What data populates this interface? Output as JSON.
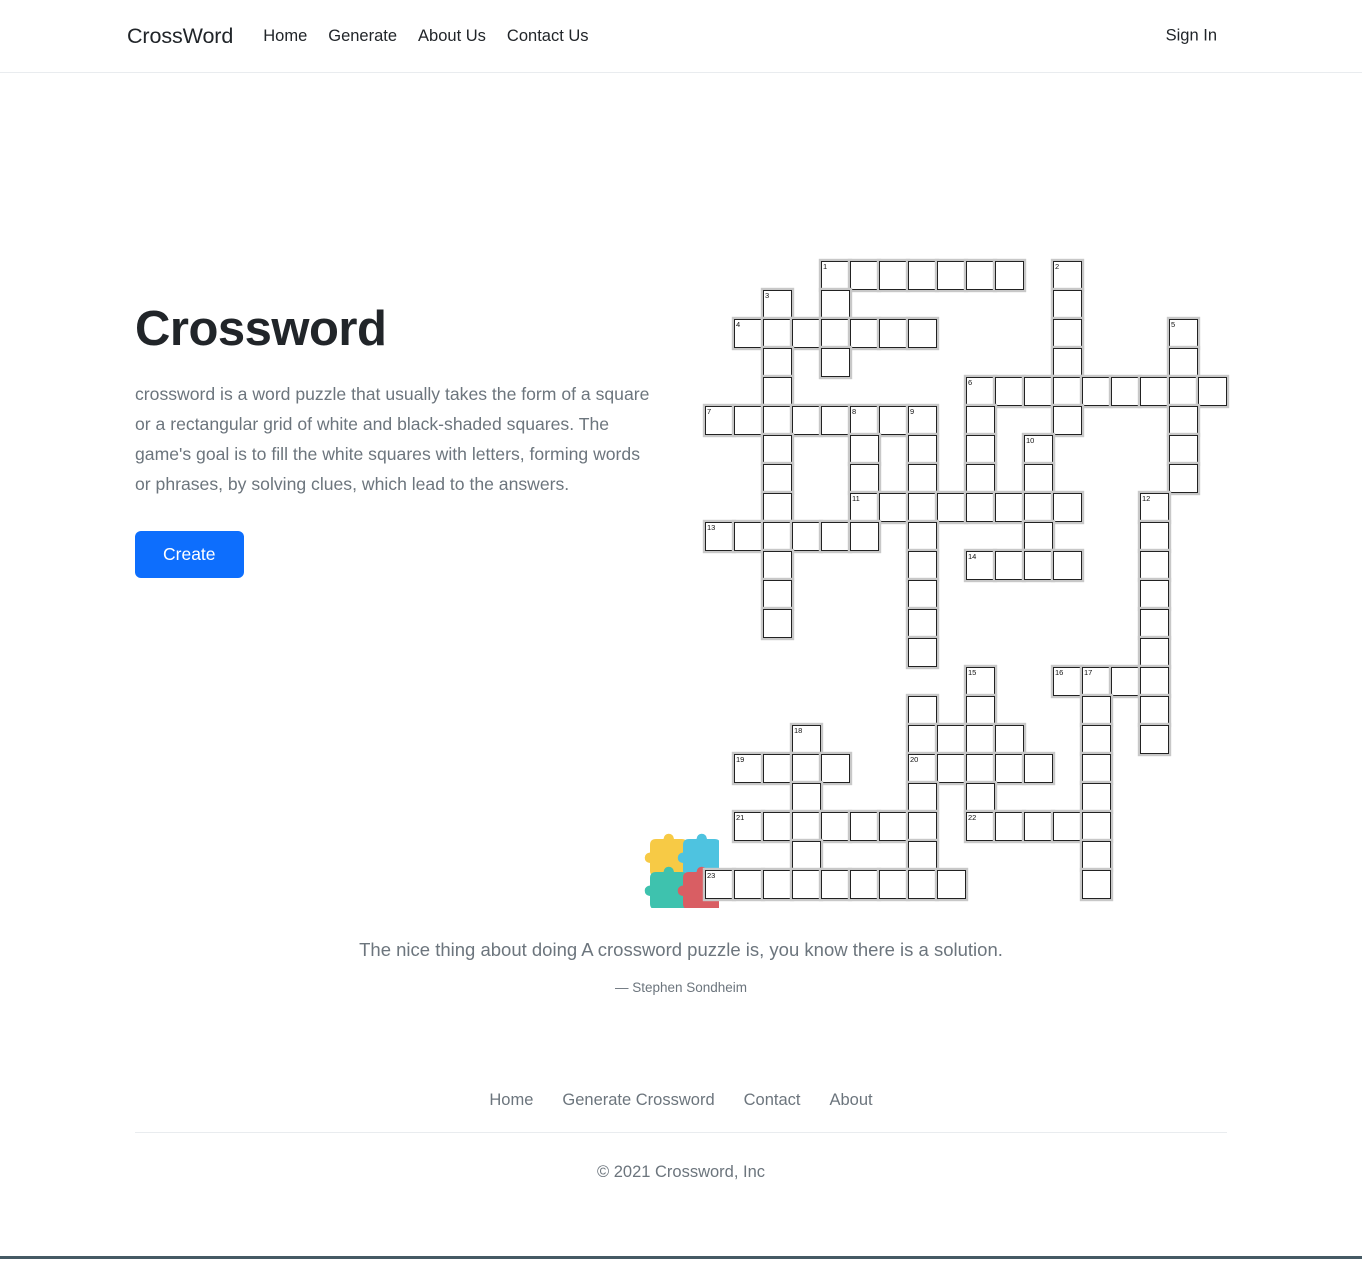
{
  "navbar": {
    "brand": "CrossWord",
    "links": [
      {
        "label": "Home",
        "name": "nav-link-home"
      },
      {
        "label": "Generate",
        "name": "nav-link-generate"
      },
      {
        "label": "About Us",
        "name": "nav-link-about-us"
      },
      {
        "label": "Contact Us",
        "name": "nav-link-contact-us"
      }
    ],
    "sign_in": "Sign In"
  },
  "hero": {
    "title": "Crossword",
    "description": "crossword is a word puzzle that usually takes the form of a square or a rectangular grid of white and black-shaded squares. The game's goal is to fill the white squares with letters, forming words or phrases, by solving clues, which lead to the answers.",
    "create_button": "Create",
    "illustration_name": "crossword-grid-illustration"
  },
  "crossword": {
    "cell_size": 29,
    "numbers": [
      1,
      2,
      3,
      4,
      5,
      6,
      7,
      8,
      9,
      10,
      11,
      12,
      13,
      14,
      15,
      16,
      17,
      18,
      19,
      20,
      21,
      22,
      23
    ],
    "cells": [
      {
        "c": 4,
        "r": 0,
        "n": "1"
      },
      {
        "c": 5,
        "r": 0
      },
      {
        "c": 6,
        "r": 0
      },
      {
        "c": 7,
        "r": 0
      },
      {
        "c": 8,
        "r": 0
      },
      {
        "c": 9,
        "r": 0
      },
      {
        "c": 10,
        "r": 0
      },
      {
        "c": 12,
        "r": 0,
        "n": "2"
      },
      {
        "c": 2,
        "r": 1,
        "n": "3"
      },
      {
        "c": 4,
        "r": 1
      },
      {
        "c": 12,
        "r": 1
      },
      {
        "c": 1,
        "r": 2,
        "n": "4"
      },
      {
        "c": 2,
        "r": 2
      },
      {
        "c": 3,
        "r": 2
      },
      {
        "c": 4,
        "r": 2
      },
      {
        "c": 5,
        "r": 2
      },
      {
        "c": 6,
        "r": 2
      },
      {
        "c": 7,
        "r": 2
      },
      {
        "c": 12,
        "r": 2
      },
      {
        "c": 16,
        "r": 2,
        "n": "5"
      },
      {
        "c": 2,
        "r": 3
      },
      {
        "c": 4,
        "r": 3
      },
      {
        "c": 12,
        "r": 3
      },
      {
        "c": 16,
        "r": 3
      },
      {
        "c": 2,
        "r": 4
      },
      {
        "c": 9,
        "r": 4,
        "n": "6"
      },
      {
        "c": 10,
        "r": 4
      },
      {
        "c": 11,
        "r": 4
      },
      {
        "c": 12,
        "r": 4
      },
      {
        "c": 13,
        "r": 4
      },
      {
        "c": 14,
        "r": 4
      },
      {
        "c": 15,
        "r": 4
      },
      {
        "c": 16,
        "r": 4
      },
      {
        "c": 17,
        "r": 4
      },
      {
        "c": 0,
        "r": 5,
        "n": "7"
      },
      {
        "c": 1,
        "r": 5
      },
      {
        "c": 2,
        "r": 5
      },
      {
        "c": 3,
        "r": 5
      },
      {
        "c": 4,
        "r": 5
      },
      {
        "c": 5,
        "r": 5,
        "n": "8"
      },
      {
        "c": 6,
        "r": 5
      },
      {
        "c": 7,
        "r": 5,
        "n": "9"
      },
      {
        "c": 9,
        "r": 5
      },
      {
        "c": 12,
        "r": 5
      },
      {
        "c": 16,
        "r": 5
      },
      {
        "c": 2,
        "r": 6
      },
      {
        "c": 5,
        "r": 6
      },
      {
        "c": 7,
        "r": 6
      },
      {
        "c": 9,
        "r": 6
      },
      {
        "c": 11,
        "r": 6,
        "n": "10"
      },
      {
        "c": 16,
        "r": 6
      },
      {
        "c": 2,
        "r": 7
      },
      {
        "c": 5,
        "r": 7
      },
      {
        "c": 7,
        "r": 7
      },
      {
        "c": 9,
        "r": 7
      },
      {
        "c": 11,
        "r": 7
      },
      {
        "c": 16,
        "r": 7
      },
      {
        "c": 2,
        "r": 8
      },
      {
        "c": 5,
        "r": 8,
        "n": "11"
      },
      {
        "c": 6,
        "r": 8
      },
      {
        "c": 7,
        "r": 8
      },
      {
        "c": 8,
        "r": 8
      },
      {
        "c": 9,
        "r": 8
      },
      {
        "c": 10,
        "r": 8
      },
      {
        "c": 11,
        "r": 8
      },
      {
        "c": 12,
        "r": 8
      },
      {
        "c": 15,
        "r": 8,
        "n": "12"
      },
      {
        "c": 0,
        "r": 9,
        "n": "13"
      },
      {
        "c": 1,
        "r": 9
      },
      {
        "c": 2,
        "r": 9
      },
      {
        "c": 3,
        "r": 9
      },
      {
        "c": 4,
        "r": 9
      },
      {
        "c": 5,
        "r": 9
      },
      {
        "c": 7,
        "r": 9
      },
      {
        "c": 11,
        "r": 9
      },
      {
        "c": 15,
        "r": 9
      },
      {
        "c": 2,
        "r": 10
      },
      {
        "c": 7,
        "r": 10
      },
      {
        "c": 9,
        "r": 10,
        "n": "14"
      },
      {
        "c": 10,
        "r": 10
      },
      {
        "c": 11,
        "r": 10
      },
      {
        "c": 12,
        "r": 10
      },
      {
        "c": 15,
        "r": 10
      },
      {
        "c": 2,
        "r": 11
      },
      {
        "c": 7,
        "r": 11
      },
      {
        "c": 15,
        "r": 11
      },
      {
        "c": 2,
        "r": 12
      },
      {
        "c": 7,
        "r": 12
      },
      {
        "c": 15,
        "r": 12
      },
      {
        "c": 7,
        "r": 13
      },
      {
        "c": 15,
        "r": 13
      },
      {
        "c": 9,
        "r": 14,
        "n": "15"
      },
      {
        "c": 12,
        "r": 14,
        "n": "16"
      },
      {
        "c": 13,
        "r": 14,
        "n": "17"
      },
      {
        "c": 14,
        "r": 14
      },
      {
        "c": 15,
        "r": 14
      },
      {
        "c": 7,
        "r": 15
      },
      {
        "c": 9,
        "r": 15
      },
      {
        "c": 13,
        "r": 15
      },
      {
        "c": 15,
        "r": 15
      },
      {
        "c": 3,
        "r": 16,
        "n": "18"
      },
      {
        "c": 7,
        "r": 16
      },
      {
        "c": 8,
        "r": 16
      },
      {
        "c": 9,
        "r": 16
      },
      {
        "c": 10,
        "r": 16
      },
      {
        "c": 13,
        "r": 16
      },
      {
        "c": 15,
        "r": 16
      },
      {
        "c": 1,
        "r": 17,
        "n": "19"
      },
      {
        "c": 2,
        "r": 17
      },
      {
        "c": 3,
        "r": 17
      },
      {
        "c": 4,
        "r": 17
      },
      {
        "c": 7,
        "r": 17,
        "n": "20"
      },
      {
        "c": 8,
        "r": 17
      },
      {
        "c": 9,
        "r": 17
      },
      {
        "c": 10,
        "r": 17
      },
      {
        "c": 11,
        "r": 17
      },
      {
        "c": 13,
        "r": 17
      },
      {
        "c": 3,
        "r": 18
      },
      {
        "c": 7,
        "r": 18
      },
      {
        "c": 9,
        "r": 18
      },
      {
        "c": 13,
        "r": 18
      },
      {
        "c": 1,
        "r": 19,
        "n": "21"
      },
      {
        "c": 2,
        "r": 19
      },
      {
        "c": 3,
        "r": 19
      },
      {
        "c": 4,
        "r": 19
      },
      {
        "c": 5,
        "r": 19
      },
      {
        "c": 6,
        "r": 19
      },
      {
        "c": 7,
        "r": 19
      },
      {
        "c": 9,
        "r": 19,
        "n": "22"
      },
      {
        "c": 10,
        "r": 19
      },
      {
        "c": 11,
        "r": 19
      },
      {
        "c": 12,
        "r": 19
      },
      {
        "c": 13,
        "r": 19
      },
      {
        "c": 3,
        "r": 20
      },
      {
        "c": 7,
        "r": 20
      },
      {
        "c": 13,
        "r": 20
      },
      {
        "c": 0,
        "r": 21,
        "n": "23"
      },
      {
        "c": 1,
        "r": 21
      },
      {
        "c": 2,
        "r": 21
      },
      {
        "c": 3,
        "r": 21
      },
      {
        "c": 4,
        "r": 21
      },
      {
        "c": 5,
        "r": 21
      },
      {
        "c": 6,
        "r": 21
      },
      {
        "c": 7,
        "r": 21
      },
      {
        "c": 8,
        "r": 21
      },
      {
        "c": 13,
        "r": 21
      }
    ]
  },
  "quote": {
    "text": "The nice thing about doing A crossword puzzle is, you know there is a solution.",
    "author": "— Stephen Sondheim",
    "logo_name": "puzzle-pieces-logo",
    "logo_colors": {
      "top_left": "#f7ca45",
      "top_right": "#4ec3e0",
      "bottom_left": "#3ec2ae",
      "bottom_right": "#d95e63"
    }
  },
  "footer": {
    "links": [
      {
        "label": "Home",
        "name": "footer-link-home"
      },
      {
        "label": "Generate Crossword",
        "name": "footer-link-generate-crossword"
      },
      {
        "label": "Contact",
        "name": "footer-link-contact"
      },
      {
        "label": "About",
        "name": "footer-link-about"
      }
    ],
    "copyright": "© 2021 Crossword, Inc"
  },
  "theme": {
    "accent": "#0d6efd",
    "muted_text": "#6c757d",
    "bottom_bar": "#455a64"
  }
}
